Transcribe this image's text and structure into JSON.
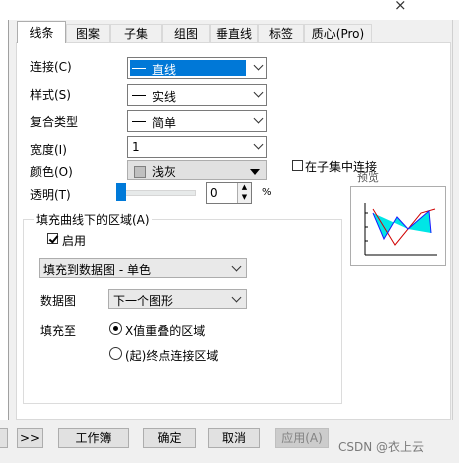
{
  "window": {
    "close_glyph": "×"
  },
  "tabs": [
    {
      "label": "线条",
      "active": true
    },
    {
      "label": "图案"
    },
    {
      "label": "子集"
    },
    {
      "label": "组图"
    },
    {
      "label": "垂直线"
    },
    {
      "label": "标签"
    },
    {
      "label": "质心(Pro)"
    }
  ],
  "form": {
    "connect": {
      "label": "连接(C)",
      "value": "直线"
    },
    "style": {
      "label": "样式(S)",
      "value": "实线"
    },
    "compound": {
      "label": "复合类型",
      "value": "简单"
    },
    "width": {
      "label": "宽度(I)",
      "value": "1"
    },
    "color": {
      "label": "颜色(O)",
      "value": "浅灰",
      "swatch": "#c0c0c0"
    },
    "subset_connect": {
      "label": "在子集中连接",
      "checked": false
    },
    "transparency": {
      "label": "透明(T)",
      "value": "0",
      "unit": "%",
      "slider_fraction": 0.0
    }
  },
  "preview": {
    "label": "预览"
  },
  "fill": {
    "group_label": "填充曲线下的区域(A)",
    "enable": {
      "label": "启用",
      "checked": true
    },
    "mode_value": "填充到数据图 - 单色",
    "plot_label": "数据图",
    "plot_value": "下一个图形",
    "fill_to_label": "填充至",
    "options": [
      {
        "label": "X值重叠的区域",
        "selected": true
      },
      {
        "label": "(起)终点连接区域",
        "selected": false
      }
    ]
  },
  "footer": {
    "more": ">>",
    "workbook": "工作簿",
    "ok": "确定",
    "cancel": "取消",
    "apply": "应用(A)"
  },
  "watermark": "CSDN @衣上云"
}
